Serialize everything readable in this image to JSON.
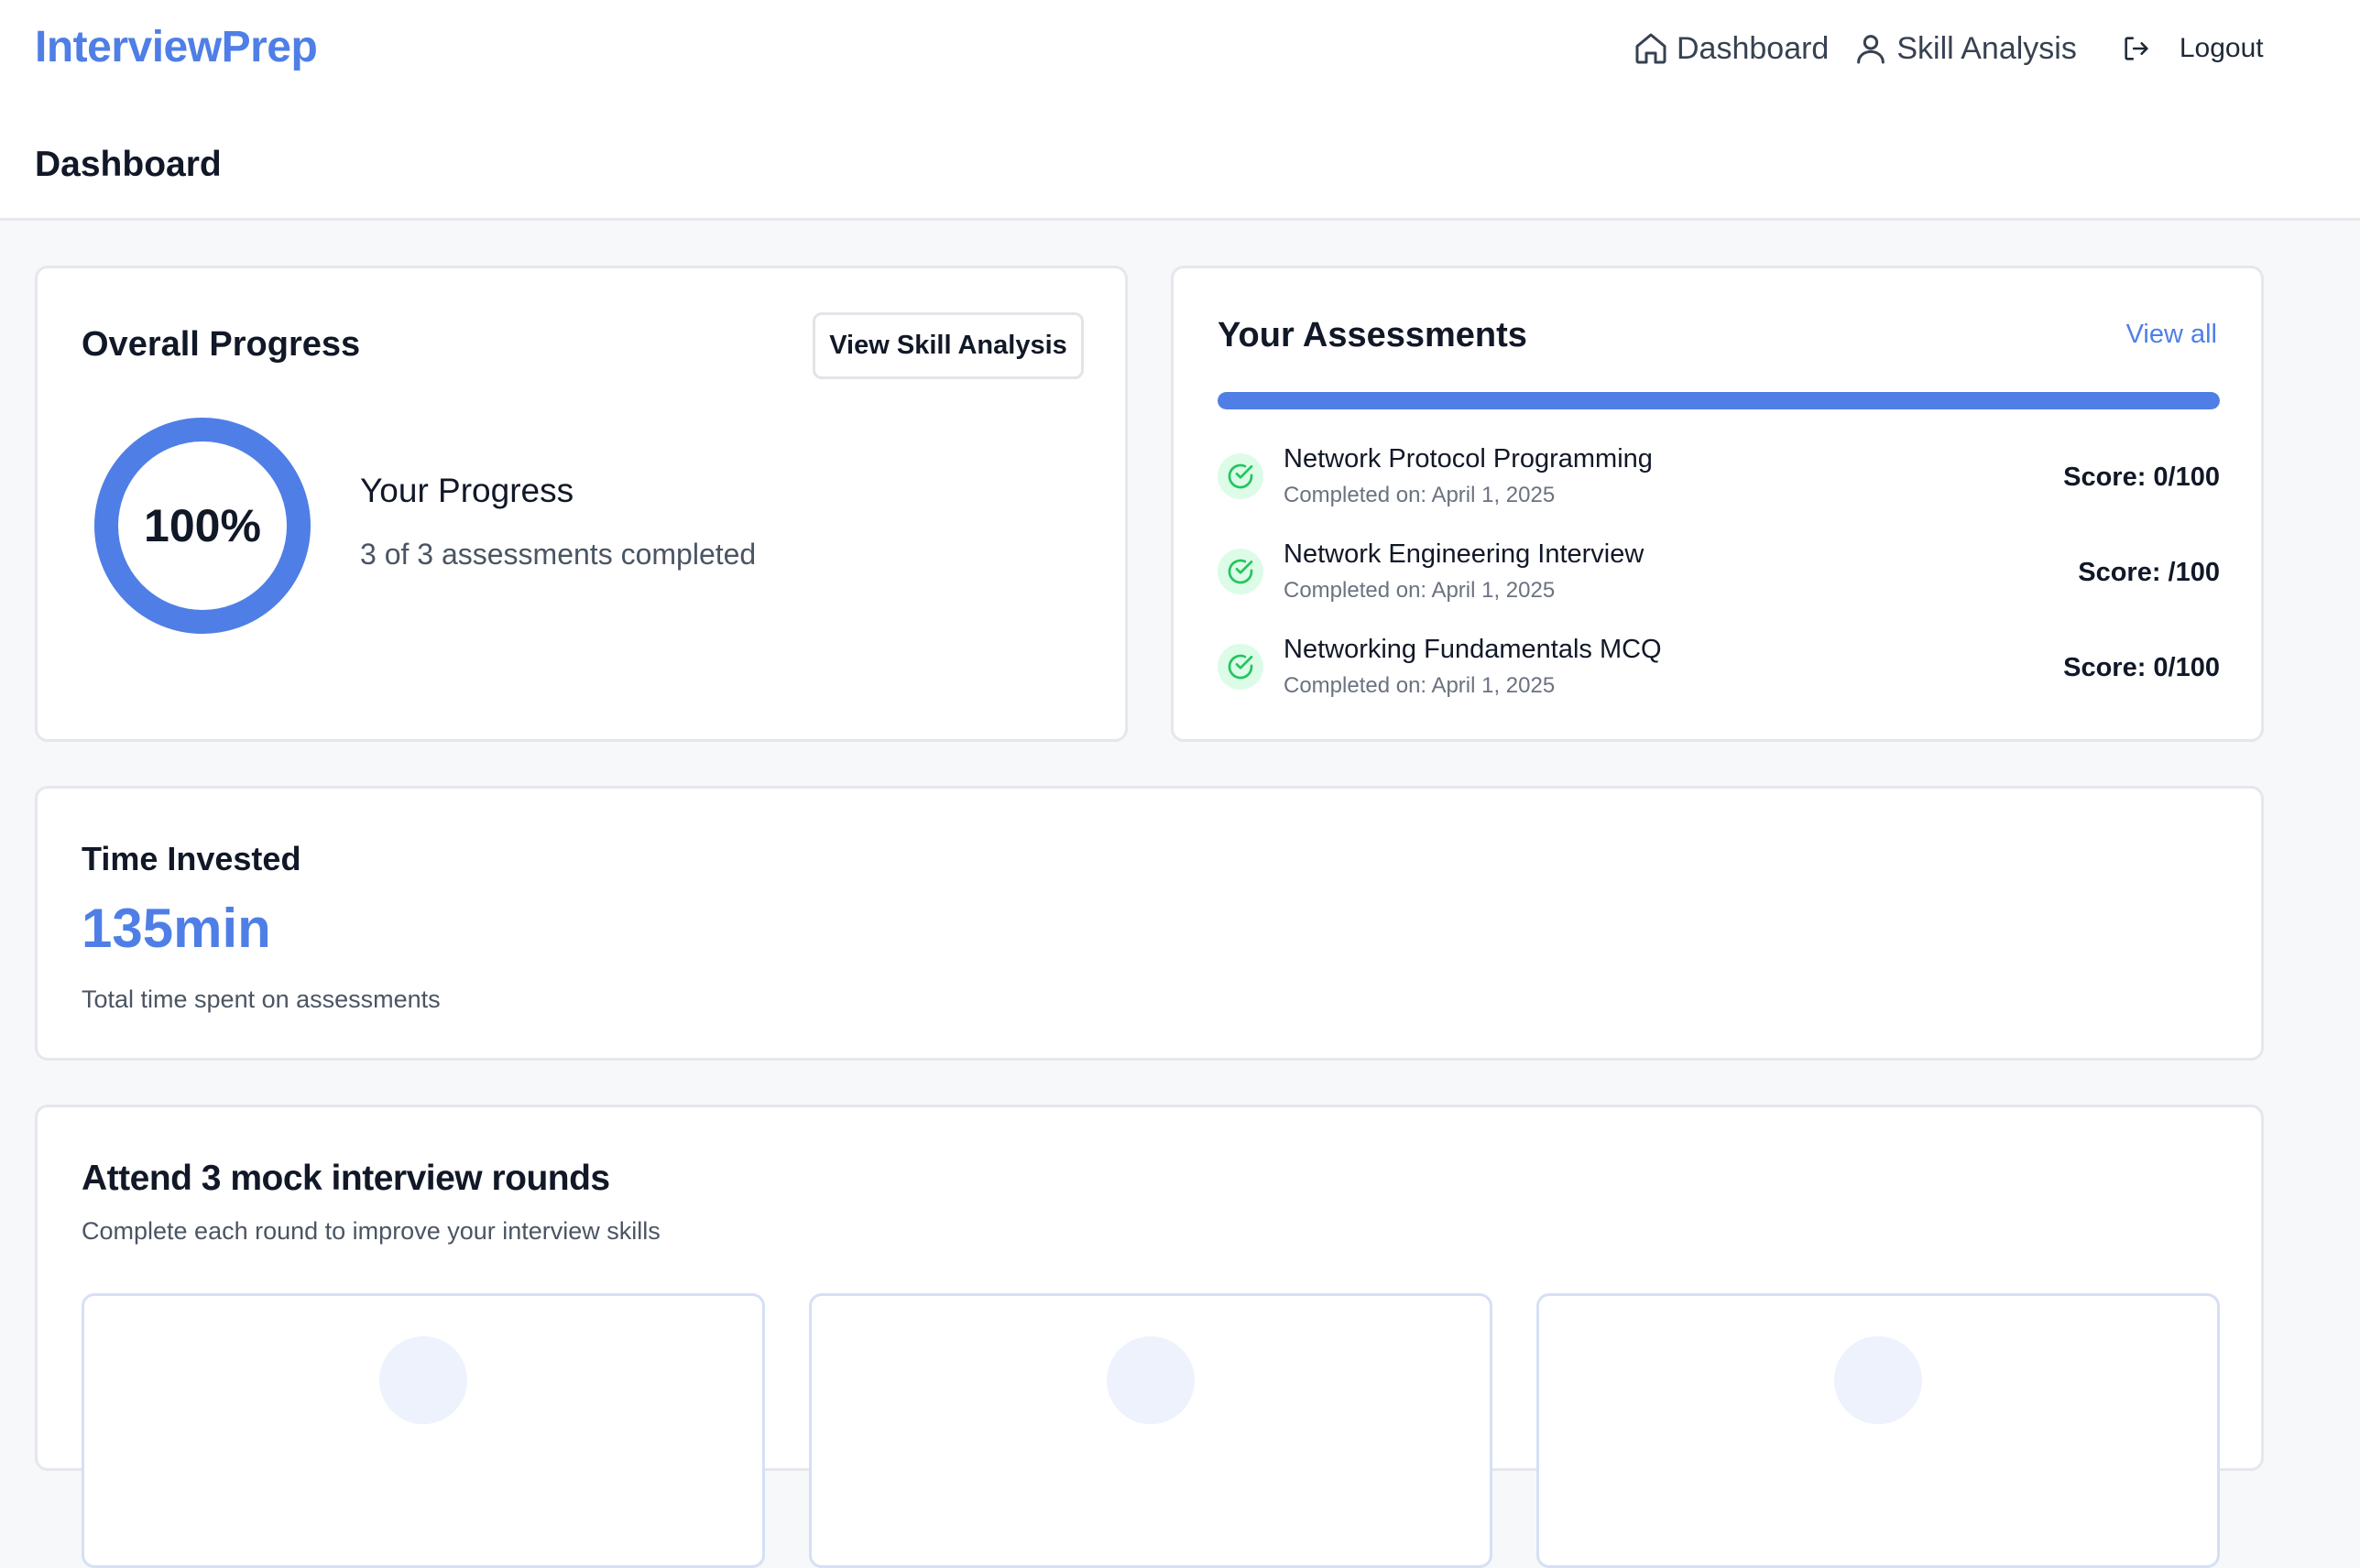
{
  "header": {
    "brand": "InterviewPrep",
    "page_title": "Dashboard",
    "nav": [
      {
        "label": "Dashboard",
        "icon": "home-icon"
      },
      {
        "label": "Skill Analysis",
        "icon": "user-icon"
      },
      {
        "label": "Logout",
        "icon": "logout-icon"
      }
    ]
  },
  "progress": {
    "title": "Overall Progress",
    "button_label": "View Skill Analysis",
    "percent_label": "100%",
    "percent_value": 100,
    "subtitle": "Your Progress",
    "detail": "3 of 3 assessments completed"
  },
  "assessments": {
    "title": "Your Assessments",
    "view_all": "View all",
    "bar_fill_fraction": 1.0,
    "items": [
      {
        "name": "Network Protocol Programming",
        "date": "Completed on: April 1, 2025",
        "score": "Score: 0/100"
      },
      {
        "name": "Network Engineering Interview",
        "date": "Completed on: April 1, 2025",
        "score": "Score: /100"
      },
      {
        "name": "Networking Fundamentals MCQ",
        "date": "Completed on: April 1, 2025",
        "score": "Score: 0/100"
      }
    ]
  },
  "time": {
    "title": "Time Invested",
    "value": "135min",
    "subtitle": "Total time spent on assessments"
  },
  "mock": {
    "title": "Attend 3 mock interview rounds",
    "subtitle": "Complete each round to improve your interview skills"
  },
  "colors": {
    "accent": "#4f7fe6",
    "success": "#22c55e",
    "success_bg": "#dcfce7"
  }
}
